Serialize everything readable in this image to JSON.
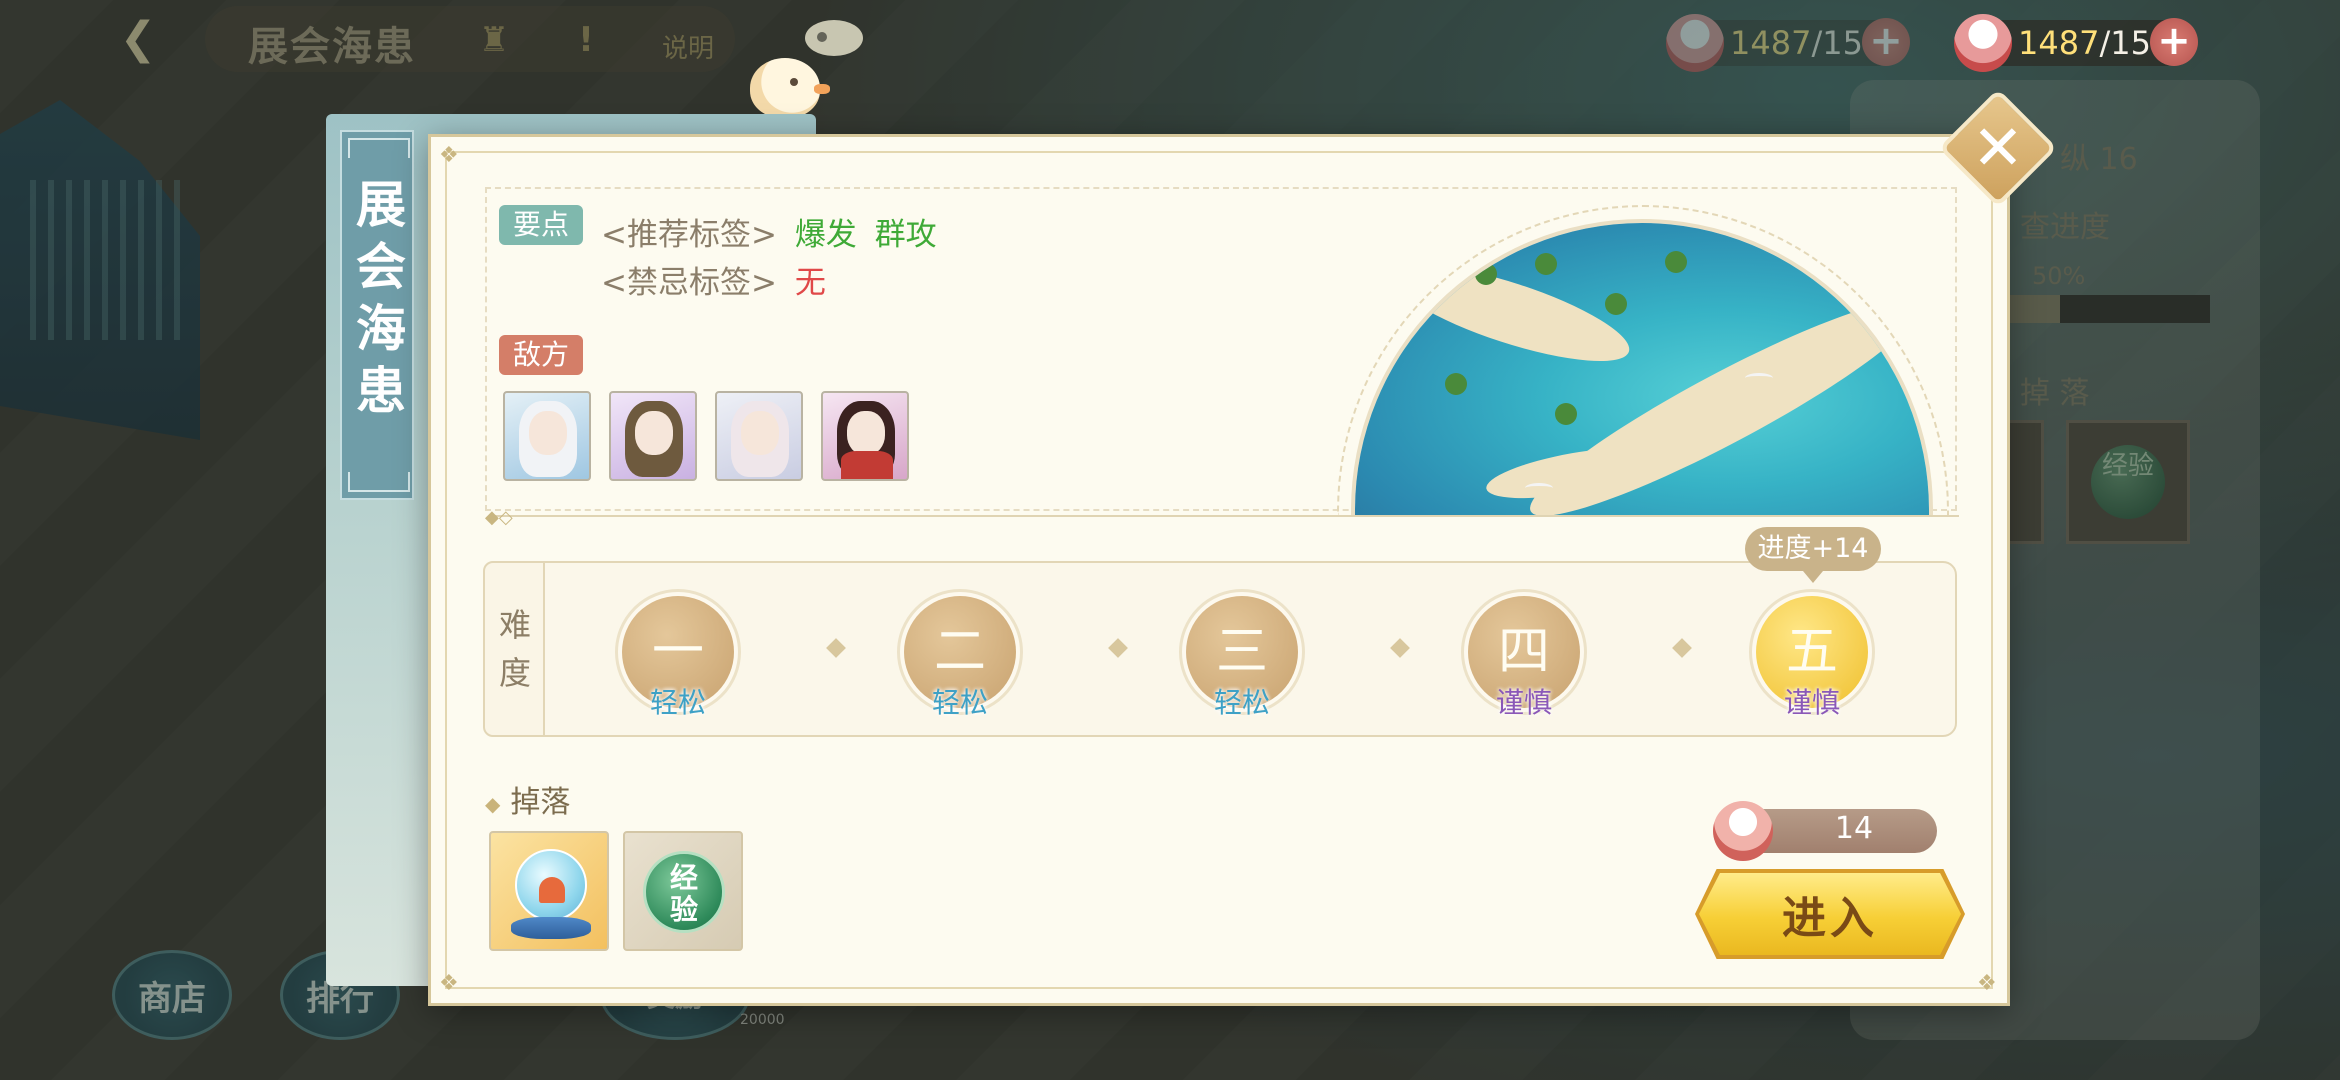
{
  "topbar": {
    "title": "展会海患",
    "help_label": "说明",
    "currency_dim": {
      "amount": "1487",
      "max": "/150"
    },
    "currency": {
      "amount": "1487",
      "max": "/150"
    }
  },
  "side_panel": {
    "line1": "纵 16",
    "progress_label": "查进度",
    "progress_value": "50%",
    "drop_label": "掉 落",
    "exp_label": "经验"
  },
  "bottom_nav": {
    "shop": "商店",
    "rank": "排行",
    "reward_count": "20000",
    "reward_label": "奖励"
  },
  "banner": {
    "title": "展会海患"
  },
  "card": {
    "key_tag": "要点",
    "recommend_label": "<推荐标签>",
    "recommend_tags": [
      "爆发",
      "群攻"
    ],
    "forbidden_label": "<禁忌标签>",
    "forbidden_value": "无",
    "enemy_tag": "敌方",
    "difficulty_title_1": "难",
    "difficulty_title_2": "度",
    "levels": [
      {
        "numeral": "一",
        "label": "轻松",
        "tone": "easy"
      },
      {
        "numeral": "二",
        "label": "轻松",
        "tone": "easy"
      },
      {
        "numeral": "三",
        "label": "轻松",
        "tone": "easy"
      },
      {
        "numeral": "四",
        "label": "谨慎",
        "tone": "careful"
      },
      {
        "numeral": "五",
        "label": "谨慎",
        "tone": "careful"
      }
    ],
    "progress_bonus": "进度+14",
    "drop_title": "掉落",
    "drop_exp_label_1": "经",
    "drop_exp_label_2": "验",
    "cost": "14",
    "enter_label": "进入"
  },
  "colors": {
    "accent_gold": "#f7cf36",
    "easy": "#3ea1c6",
    "careful": "#8a58b8",
    "recommend": "#3faa37",
    "forbidden": "#e04848"
  }
}
